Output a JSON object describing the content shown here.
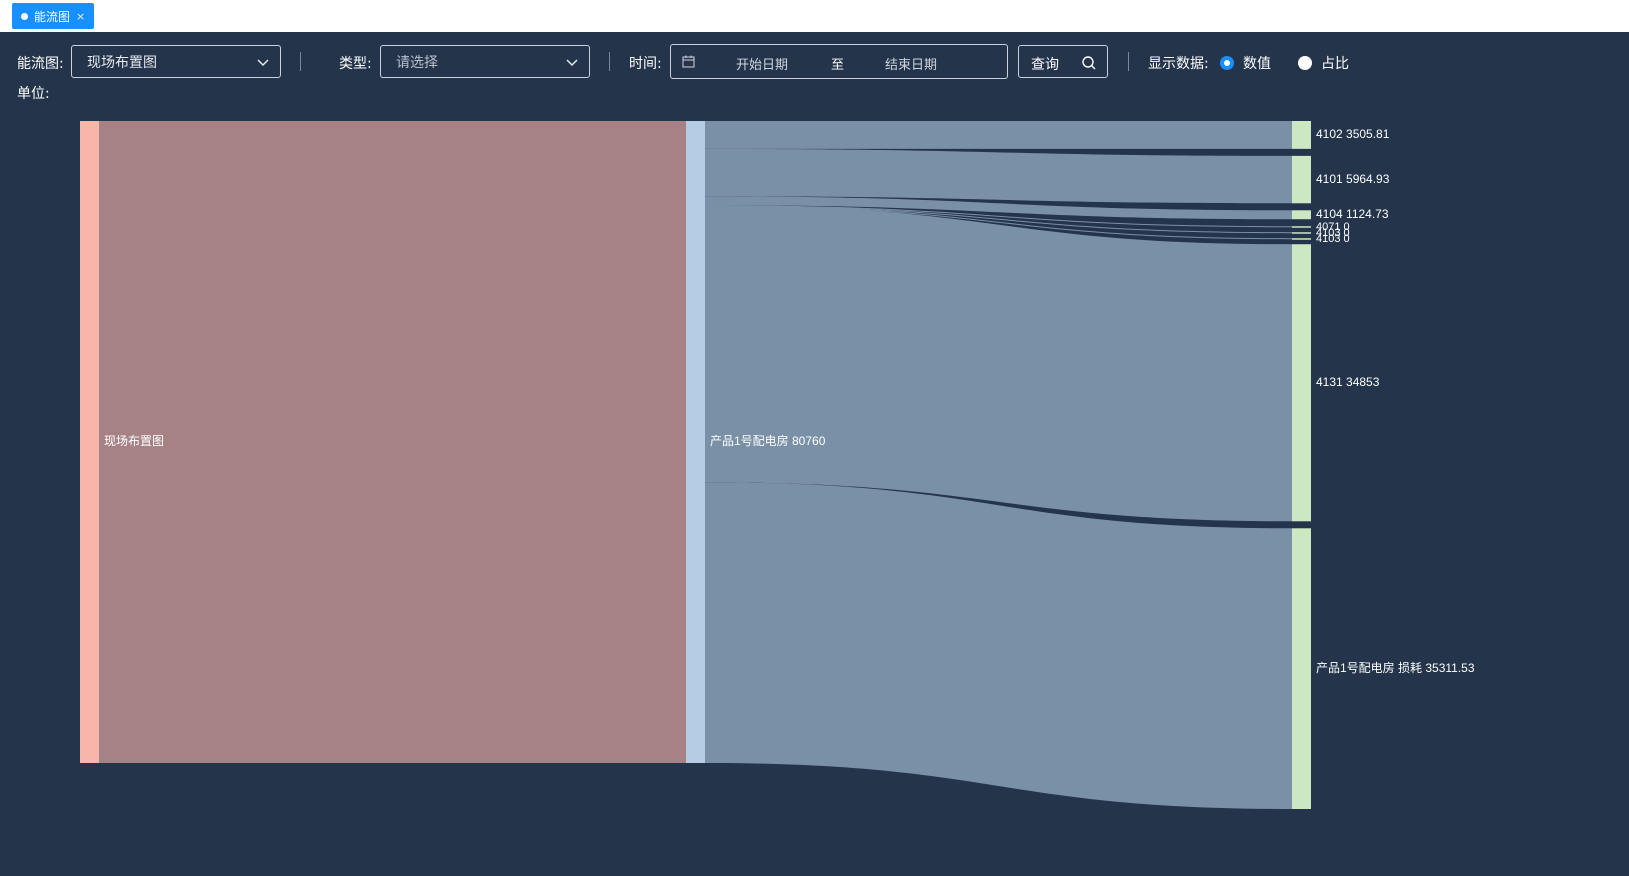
{
  "tab": {
    "label": "能流图",
    "close": "×"
  },
  "toolbar": {
    "flow_label": "能流图:",
    "flow_value": "现场布置图",
    "type_label": "类型:",
    "type_placeholder": "请选择",
    "time_label": "时间:",
    "date_start": "开始日期",
    "date_sep": "至",
    "date_end": "结束日期",
    "query_label": "查询",
    "display_label": "显示数据:",
    "radio_value": "数值",
    "radio_ratio": "占比",
    "selected": "数值"
  },
  "unit_label": "单位:",
  "colors": {
    "background": "#24344b",
    "accent": "#1890ff",
    "root_node": "#f8b5a9",
    "mid_node": "#b4cde4",
    "leaf_node": "#cbe8c2",
    "link_root": "#a78285",
    "link_leaf": "#7a90a7"
  },
  "chart_data": {
    "type": "sankey",
    "nodes": [
      {
        "id": "root",
        "label": "现场布置图",
        "value": 80760
      },
      {
        "id": "dist",
        "label": "产品1号配电房 80760",
        "value": 80760
      },
      {
        "id": "4102",
        "label": "4102 3505.81",
        "value": 3505.81
      },
      {
        "id": "4101",
        "label": "4101 5964.93",
        "value": 5964.93
      },
      {
        "id": "4104",
        "label": "4104 1124.73",
        "value": 1124.73
      },
      {
        "id": "4071",
        "label": "4071 0",
        "value": 0
      },
      {
        "id": "4103a",
        "label": "4103 0",
        "value": 0
      },
      {
        "id": "4103b",
        "label": "4103 0",
        "value": 0
      },
      {
        "id": "4131",
        "label": "4131 34853",
        "value": 34853
      },
      {
        "id": "loss",
        "label": "产品1号配电房 损耗 35311.53",
        "value": 35311.53
      }
    ],
    "links": [
      {
        "source": "root",
        "target": "dist",
        "value": 80760
      },
      {
        "source": "dist",
        "target": "4102",
        "value": 3505.81
      },
      {
        "source": "dist",
        "target": "4101",
        "value": 5964.93
      },
      {
        "source": "dist",
        "target": "4104",
        "value": 1124.73
      },
      {
        "source": "dist",
        "target": "4071",
        "value": 0
      },
      {
        "source": "dist",
        "target": "4103a",
        "value": 0
      },
      {
        "source": "dist",
        "target": "4103b",
        "value": 0
      },
      {
        "source": "dist",
        "target": "4131",
        "value": 34853
      },
      {
        "source": "dist",
        "target": "loss",
        "value": 35311.53
      }
    ]
  }
}
